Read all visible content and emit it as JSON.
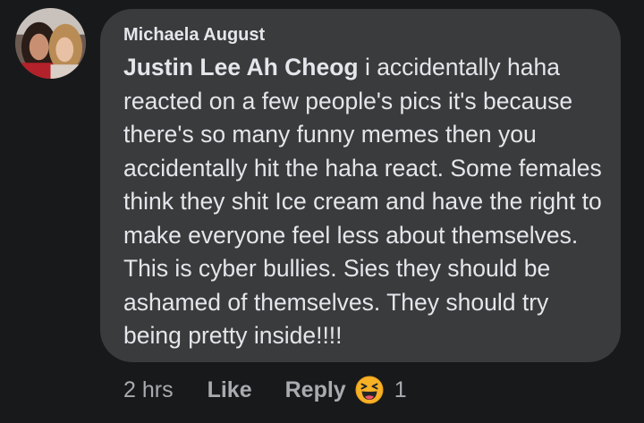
{
  "comment": {
    "author": "Michaela August",
    "mention": "Justin Lee Ah Cheog",
    "text": " i accidentally haha reacted on a few people's pics it's because there's so many funny memes then you accidentally hit the haha react. Some females think they shit Ice cream and have the right to make everyone feel less about themselves. This is cyber bullies. Sies they should be ashamed of themselves. They should try being pretty inside!!!!",
    "timestamp": "2 hrs",
    "like_label": "Like",
    "reply_label": "Reply",
    "reaction_icon": "haha-reaction-icon",
    "reaction_count": "1"
  },
  "colors": {
    "background": "#18191a",
    "bubble": "#3a3b3c",
    "text": "#e4e6eb",
    "secondary_text": "#a8abaf",
    "haha_yellow": "#f7b125"
  }
}
